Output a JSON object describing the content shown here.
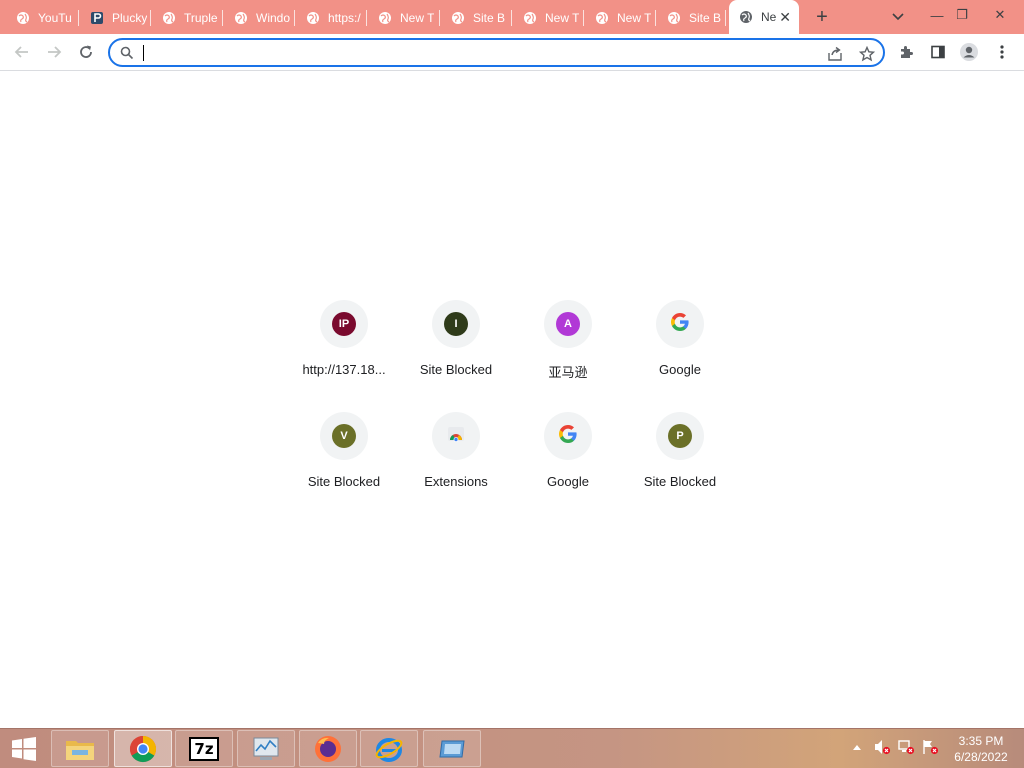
{
  "tabs": [
    {
      "title": "YouTu",
      "icon": "globe-icon"
    },
    {
      "title": "Plucky",
      "icon": "p-logo-icon"
    },
    {
      "title": "Truple",
      "icon": "globe-icon"
    },
    {
      "title": "Windo",
      "icon": "globe-icon"
    },
    {
      "title": "https:/",
      "icon": "globe-icon"
    },
    {
      "title": "New T",
      "icon": "globe-icon"
    },
    {
      "title": "Site B",
      "icon": "globe-icon"
    },
    {
      "title": "New T",
      "icon": "globe-icon"
    },
    {
      "title": "New T",
      "icon": "globe-icon"
    },
    {
      "title": "Site B",
      "icon": "globe-icon"
    }
  ],
  "active_tab": {
    "title": "Ne",
    "icon": "globe-icon",
    "close": "✕"
  },
  "new_tab_symbol": "+",
  "window": {
    "minimize": "—",
    "restore": "❐",
    "close": "✕"
  },
  "omnibox": {
    "value": "",
    "placeholder": ""
  },
  "shortcuts": [
    {
      "letter": "IP",
      "label": "http://137.18...",
      "color": "#7a0a2e",
      "type": "letter"
    },
    {
      "letter": "I",
      "label": "Site Blocked",
      "color": "#2f3b1a",
      "type": "letter"
    },
    {
      "letter": "A",
      "label": "亚马逊",
      "color": "#b139d6",
      "type": "letter"
    },
    {
      "letter": "",
      "label": "Google",
      "color": "",
      "type": "google"
    },
    {
      "letter": "V",
      "label": "Site Blocked",
      "color": "#6b7028",
      "type": "letter"
    },
    {
      "letter": "",
      "label": "Extensions",
      "color": "",
      "type": "extensions"
    },
    {
      "letter": "",
      "label": "Google",
      "color": "",
      "type": "google"
    },
    {
      "letter": "P",
      "label": "Site Blocked",
      "color": "#6b7028",
      "type": "letter"
    }
  ],
  "taskbar": {
    "apps": [
      "file-explorer-icon",
      "chrome-icon",
      "7zip-icon",
      "resource-monitor-icon",
      "firefox-icon",
      "internet-explorer-icon",
      "remote-desktop-icon"
    ],
    "seven_zip_label": "7z",
    "time": "3:35 PM",
    "date": "6/28/2022"
  },
  "colors": {
    "tabstrip": "#f29187",
    "omnibox_border": "#1a73e8"
  }
}
